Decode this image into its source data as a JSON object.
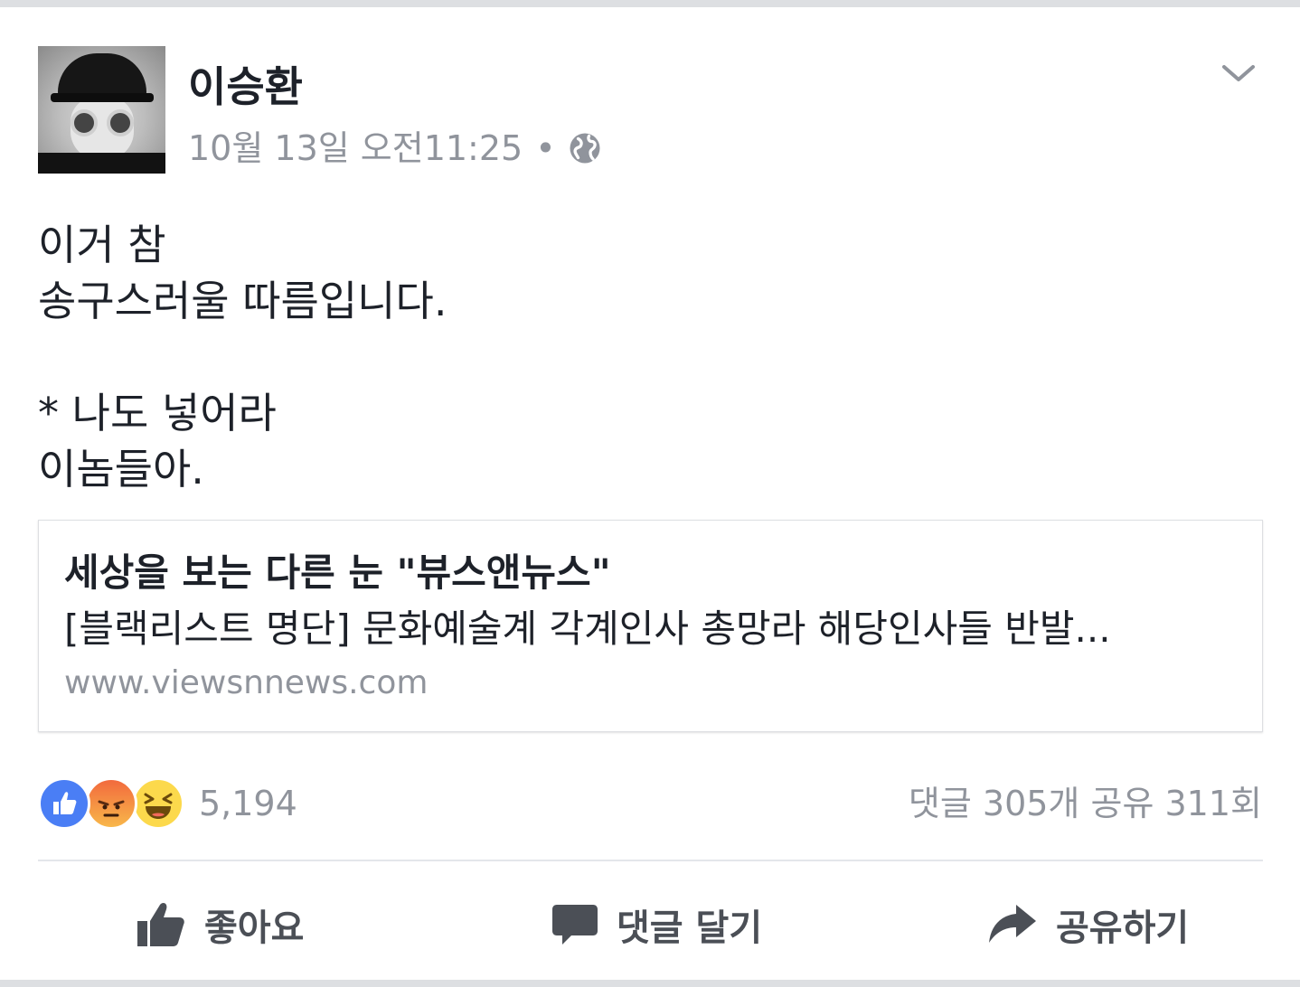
{
  "post": {
    "author": "이승환",
    "timestamp": "10월 13일 오전11:25",
    "separator": "•",
    "privacy_icon": "globe-icon",
    "menu_icon": "chevron-down-icon",
    "text": "이거 참\n송구스러울 따름입니다.\n\n* 나도 넣어라\n이놈들아."
  },
  "link_preview": {
    "title": "세상을 보는 다른 눈 \"뷰스앤뉴스\"",
    "description": "[블랙리스트 명단] 문화예술계 각계인사 총망라 해당인사들 반발...",
    "url": "www.viewsnnews.com"
  },
  "reactions": {
    "icons": [
      "like-icon",
      "angry-icon",
      "haha-icon"
    ],
    "count": "5,194"
  },
  "stats": {
    "comments": "댓글 305개",
    "shares": "공유 311회"
  },
  "actions": {
    "like_label": "좋아요",
    "comment_label": "댓글 달기",
    "share_label": "공유하기"
  },
  "colors": {
    "secondary_text": "#90949c",
    "like_blue": "#4a7ef5",
    "action_gray": "#4b4f56"
  }
}
